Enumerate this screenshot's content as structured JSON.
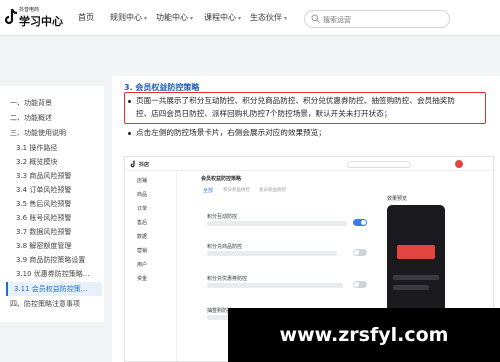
{
  "header": {
    "logo_subtitle": "抖音电商",
    "logo_title": "学习中心",
    "nav": [
      "首页",
      "规则中心",
      "功能中心",
      "课程中心",
      "生态伙伴"
    ],
    "search_placeholder": "搜索运营"
  },
  "sidebar": {
    "items": [
      "一、功能背景",
      "二、功能概述",
      "三、功能使用说明",
      "3.1 操作路径",
      "3.2 概览模块",
      "3.3 商品风险预警",
      "3.4 订单风险预警",
      "3.5 售后风险预警",
      "3.6 账号风险预警",
      "3.7 数据风险预警",
      "3.8 解密额度管理",
      "3.9 商品防控策略设置",
      "3.10 优惠券防控策略...",
      "3.11 会员权益防控策...",
      "四、防控策略注意事项"
    ]
  },
  "content": {
    "section_title": "3. 会员权益防控策略",
    "bullet1_line1": "页面一共展示了积分互动防控、积分兑商品防控、积分兑优惠券防控、抽签购防控、会员抽奖防",
    "bullet1_line2": "控、店四会员日防控、派样回购礼防控7个防控场景，默认开关未打开状态；",
    "bullet2": "点击左侧的防控场景卡片，右侧会展示对应的效果预览；"
  },
  "screenshot": {
    "app_name": "抖店",
    "page_title": "会员权益防控策略",
    "menu": [
      "店铺",
      "商品",
      "订单",
      "售后",
      "数据",
      "营销",
      "用户",
      "资金"
    ],
    "tabs": [
      "全部",
      "积分权益防控",
      "会员权益防控"
    ],
    "cards": [
      "积分互动防控",
      "积分兑商品防控",
      "积分兑优惠券防控",
      "抽签购防控"
    ],
    "preview_label": "效果预览"
  },
  "watermark": "www.zrsfyl.com",
  "colors": {
    "accent": "#1c6fd1",
    "highlight_border": "#e03030",
    "toggle_on": "#3a7bf0"
  }
}
